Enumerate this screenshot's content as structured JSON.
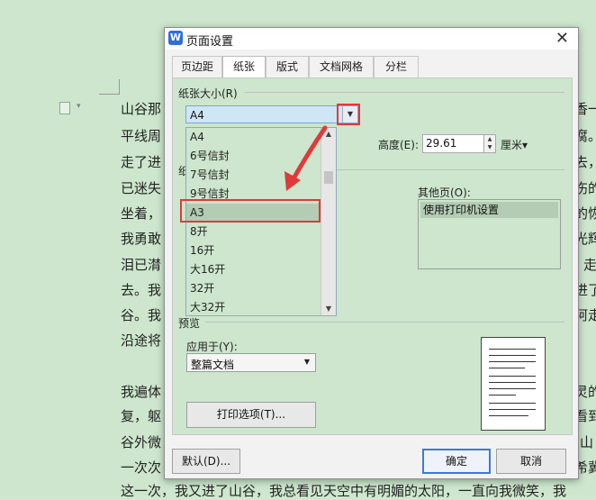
{
  "document": {
    "lines": [
      {
        "text": "山谷那",
        "right": "香一"
      },
      {
        "text": "平线周",
        "right": "腐。"
      },
      {
        "text": "走了进",
        "right": "去，"
      },
      {
        "text": "已迷失",
        "right": "伤的"
      },
      {
        "text": "坐着，",
        "right": "的恢"
      },
      {
        "text": "我勇敢",
        "right": "光辉"
      },
      {
        "text": "泪已潸",
        "right": "走"
      },
      {
        "text": "去。我",
        "right": "进了"
      },
      {
        "text": "谷。我",
        "right": "阿走"
      },
      {
        "text": "沿途将",
        "right": ""
      },
      {
        "text": "我遍体",
        "right": "灵的"
      },
      {
        "text": "复，躯",
        "right": "看到"
      },
      {
        "text": "谷外微",
        "right": "山"
      },
      {
        "text": "一次次",
        "right": "希冀"
      },
      {
        "text": "这一次，我又进了山谷，我总看见天空中有明媚的太阳，一直向我微笑，我",
        "right": ""
      }
    ]
  },
  "dialog": {
    "title": "页面设置",
    "app_icon": "W",
    "tabs": [
      {
        "label": "页边距"
      },
      {
        "label": "纸张"
      },
      {
        "label": "版式"
      },
      {
        "label": "文档网格"
      },
      {
        "label": "分栏"
      }
    ],
    "active_tab": "纸张",
    "paper_size": {
      "section_label": "纸张大小(R)",
      "value": "A4",
      "options": [
        "A4",
        "6号信封",
        "7号信封",
        "9号信封",
        "A3",
        "8开",
        "16开",
        "大16开",
        "32开",
        "大32开"
      ],
      "selected": "A3"
    },
    "height": {
      "label": "高度(E):",
      "value": "29.61",
      "unit": "厘米▾"
    },
    "partial_section_label": "纸",
    "other_pages": {
      "label": "其他页(O):",
      "items": [
        "使用打印机设置"
      ]
    },
    "preview": {
      "section_label": "预览",
      "apply_label": "应用于(Y):",
      "apply_value": "整篇文档"
    },
    "print_options_button": "打印选项(T)...",
    "default_button": "默认(D)...",
    "ok_button": "确定",
    "cancel_button": "取消"
  },
  "colors": {
    "annotation_red": "#e03a3a",
    "eye_care_green": "#cde6cd"
  },
  "icons": [
    "app-icon",
    "close-icon",
    "dropdown-caret-icon",
    "document-icon",
    "red-arrow-icon"
  ]
}
